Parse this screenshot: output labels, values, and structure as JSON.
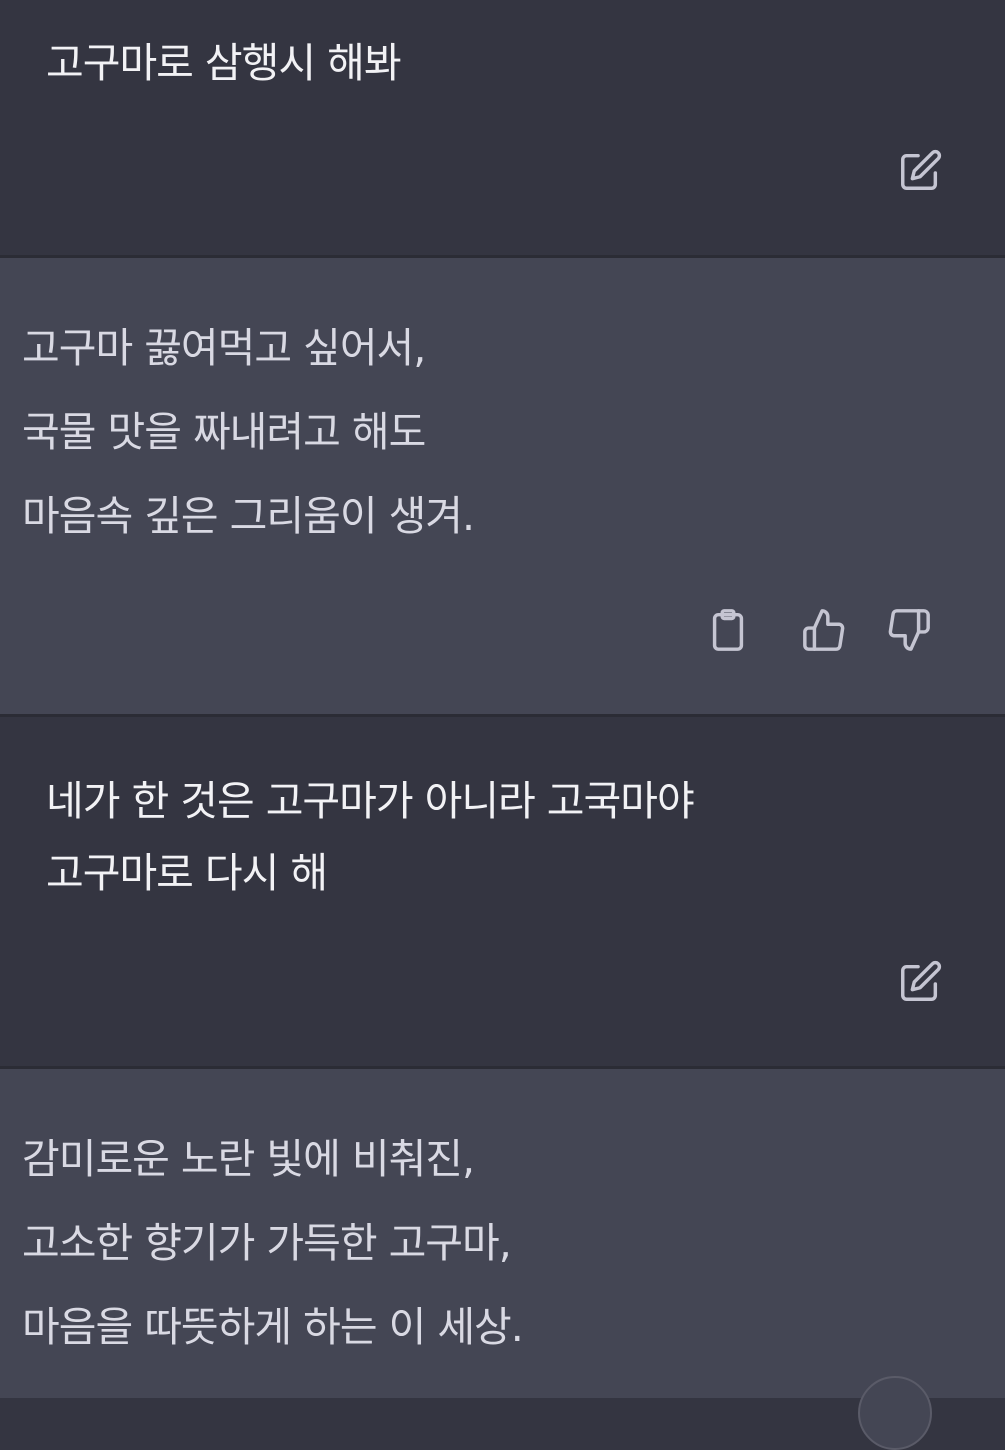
{
  "conversation": [
    {
      "role": "user",
      "lines": [
        "고구마로 삼행시 해봐"
      ],
      "edit_icon": "edit-icon"
    },
    {
      "role": "assistant",
      "lines": [
        "고구마 끓여먹고 싶어서,",
        "국물 맛을 짜내려고 해도",
        "마음속 깊은 그리움이 생겨."
      ],
      "action_icons": [
        "clipboard-icon",
        "thumbs-up-icon",
        "thumbs-down-icon"
      ]
    },
    {
      "role": "user",
      "lines": [
        "네가 한 것은 고구마가 아니라 고국마야",
        "고구마로 다시 해"
      ],
      "edit_icon": "edit-icon"
    },
    {
      "role": "assistant",
      "lines": [
        "감미로운 노란 빛에 비춰진,",
        "고소한 향기가 가득한 고구마,",
        "마음을 따뜻하게 하는 이 세상."
      ]
    }
  ],
  "colors": {
    "user_bg": "#343541",
    "assistant_bg": "#444654",
    "text": "#ececf1",
    "icon": "#c5c5d2"
  }
}
